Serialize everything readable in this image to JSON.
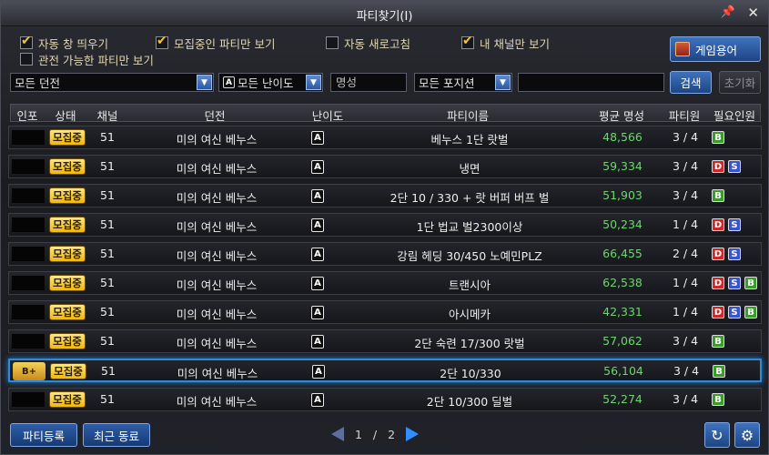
{
  "window": {
    "title": "파티찾기(I)",
    "pin_icon": "pin-icon",
    "close_icon": "close-icon"
  },
  "filters": {
    "auto_popup": {
      "label": "자동 창 띄우기",
      "checked": true
    },
    "recruiting_only": {
      "label": "모집중인 파티만 보기",
      "checked": true
    },
    "auto_refresh": {
      "label": "자동 새로고침",
      "checked": false
    },
    "my_channel_only": {
      "label": "내 채널만 보기",
      "checked": true
    },
    "spectate_only": {
      "label": "관전 가능한 파티만 보기",
      "checked": false
    },
    "guide_button": "게임용어"
  },
  "search": {
    "dungeon_select": "모든 던전",
    "difficulty_badge": "A",
    "difficulty_select": "모든 난이도",
    "score_placeholder": "명성",
    "position_select": "모든 포지션",
    "search_button": "검색",
    "reset_button": "초기화"
  },
  "columns": [
    "인포",
    "상태",
    "채널",
    "던전",
    "난이도",
    "파티이름",
    "평균 명성",
    "파티원",
    "필요인원"
  ],
  "rows": [
    {
      "cert": "",
      "status": "모집중",
      "channel": "51",
      "dungeon": "미의 여신 베누스",
      "difficulty": "A",
      "name": "베누스 1단 랏벌",
      "score": "48,566",
      "members": "3 / 4",
      "roles": [
        "B"
      ]
    },
    {
      "cert": "",
      "status": "모집중",
      "channel": "51",
      "dungeon": "미의 여신 베누스",
      "difficulty": "A",
      "name": "냉면",
      "score": "59,334",
      "members": "3 / 4",
      "roles": [
        "D",
        "S"
      ]
    },
    {
      "cert": "",
      "status": "모집중",
      "channel": "51",
      "dungeon": "미의 여신 베누스",
      "difficulty": "A",
      "name": "2단 10 / 330 + 랏 버퍼 버프 벌",
      "score": "51,903",
      "members": "3 / 4",
      "roles": [
        "B"
      ]
    },
    {
      "cert": "",
      "status": "모집중",
      "channel": "51",
      "dungeon": "미의 여신 베누스",
      "difficulty": "A",
      "name": "1단 법교 벌2300이상",
      "score": "50,234",
      "members": "1 / 4",
      "roles": [
        "D",
        "S"
      ]
    },
    {
      "cert": "",
      "status": "모집중",
      "channel": "51",
      "dungeon": "미의 여신 베누스",
      "difficulty": "A",
      "name": "강림 헤딩 30/450 노예민PLZ",
      "score": "66,455",
      "members": "2 / 4",
      "roles": [
        "D",
        "S"
      ]
    },
    {
      "cert": "",
      "status": "모집중",
      "channel": "51",
      "dungeon": "미의 여신 베누스",
      "difficulty": "A",
      "name": "트랜시아",
      "score": "62,538",
      "members": "1 / 4",
      "roles": [
        "D",
        "S",
        "B"
      ]
    },
    {
      "cert": "",
      "status": "모집중",
      "channel": "51",
      "dungeon": "미의 여신 베누스",
      "difficulty": "A",
      "name": "아시메카",
      "score": "42,331",
      "members": "1 / 4",
      "roles": [
        "D",
        "S",
        "B"
      ]
    },
    {
      "cert": "",
      "status": "모집중",
      "channel": "51",
      "dungeon": "미의 여신 베누스",
      "difficulty": "A",
      "name": "2단 숙련 17/300 랏벌",
      "score": "57,062",
      "members": "3 / 4",
      "roles": [
        "B"
      ]
    },
    {
      "cert": "B+",
      "status": "모집중",
      "channel": "51",
      "dungeon": "미의 여신 베누스",
      "difficulty": "A",
      "name": "2단 10/330",
      "score": "56,104",
      "members": "3 / 4",
      "roles": [
        "B"
      ],
      "selected": true
    },
    {
      "cert": "",
      "status": "모집중",
      "channel": "51",
      "dungeon": "미의 여신 베누스",
      "difficulty": "A",
      "name": "2단 10/300 딜벌",
      "score": "52,274",
      "members": "3 / 4",
      "roles": [
        "B"
      ]
    }
  ],
  "footer": {
    "register_button": "파티등록",
    "recent_button": "최근 동료",
    "page_current": "1",
    "page_sep": "/",
    "page_total": "2",
    "refresh_icon": "refresh-icon",
    "settings_icon": "gear-icon"
  },
  "colors": {
    "accent": "#2f8ad9",
    "score": "#6bd86b",
    "recruit": "#f0b80d"
  }
}
